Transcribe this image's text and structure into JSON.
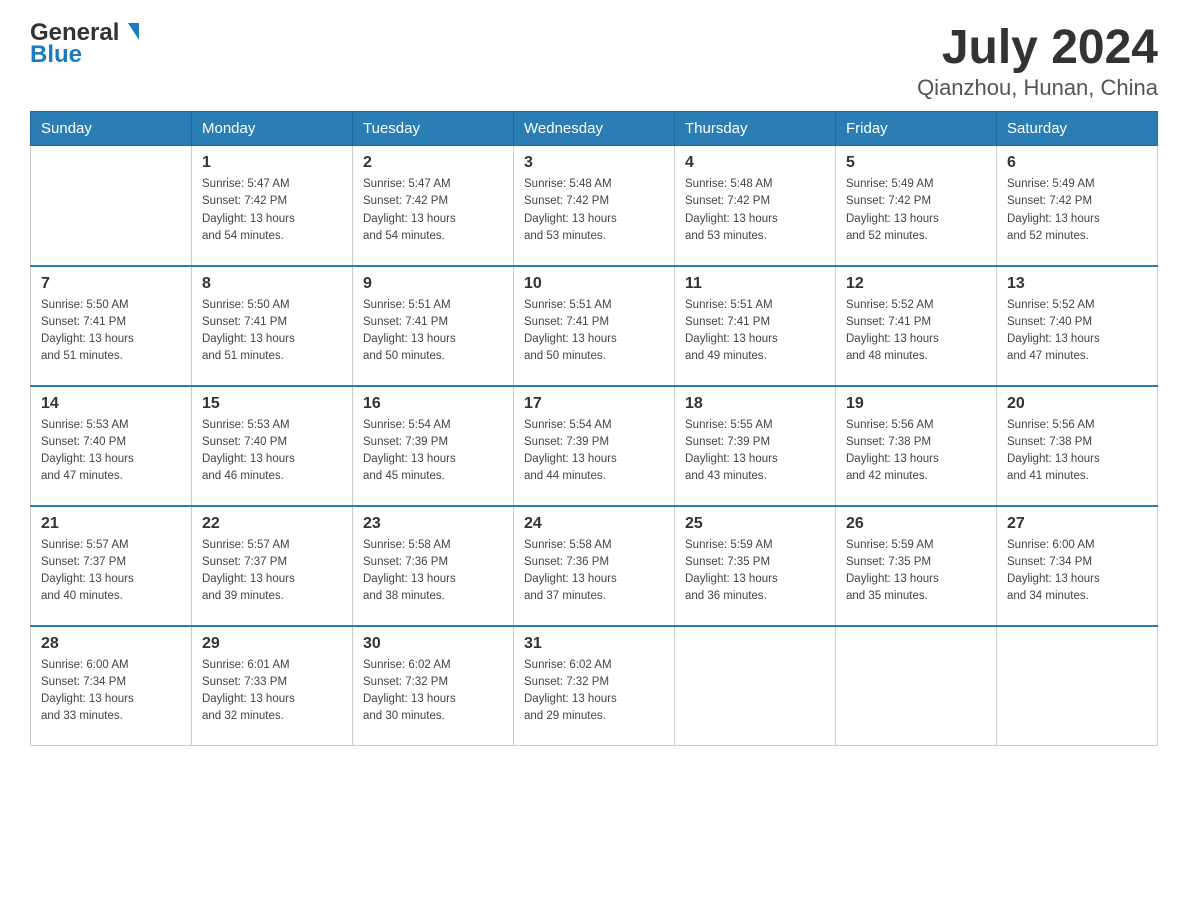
{
  "header": {
    "logo_text_general": "General",
    "logo_text_blue": "Blue",
    "title": "July 2024",
    "subtitle": "Qianzhou, Hunan, China"
  },
  "days_of_week": [
    "Sunday",
    "Monday",
    "Tuesday",
    "Wednesday",
    "Thursday",
    "Friday",
    "Saturday"
  ],
  "weeks": [
    [
      null,
      {
        "day": "1",
        "sunrise": "5:47 AM",
        "sunset": "7:42 PM",
        "daylight_hours": "13",
        "daylight_minutes": "54"
      },
      {
        "day": "2",
        "sunrise": "5:47 AM",
        "sunset": "7:42 PM",
        "daylight_hours": "13",
        "daylight_minutes": "54"
      },
      {
        "day": "3",
        "sunrise": "5:48 AM",
        "sunset": "7:42 PM",
        "daylight_hours": "13",
        "daylight_minutes": "53"
      },
      {
        "day": "4",
        "sunrise": "5:48 AM",
        "sunset": "7:42 PM",
        "daylight_hours": "13",
        "daylight_minutes": "53"
      },
      {
        "day": "5",
        "sunrise": "5:49 AM",
        "sunset": "7:42 PM",
        "daylight_hours": "13",
        "daylight_minutes": "52"
      },
      {
        "day": "6",
        "sunrise": "5:49 AM",
        "sunset": "7:42 PM",
        "daylight_hours": "13",
        "daylight_minutes": "52"
      }
    ],
    [
      {
        "day": "7",
        "sunrise": "5:50 AM",
        "sunset": "7:41 PM",
        "daylight_hours": "13",
        "daylight_minutes": "51"
      },
      {
        "day": "8",
        "sunrise": "5:50 AM",
        "sunset": "7:41 PM",
        "daylight_hours": "13",
        "daylight_minutes": "51"
      },
      {
        "day": "9",
        "sunrise": "5:51 AM",
        "sunset": "7:41 PM",
        "daylight_hours": "13",
        "daylight_minutes": "50"
      },
      {
        "day": "10",
        "sunrise": "5:51 AM",
        "sunset": "7:41 PM",
        "daylight_hours": "13",
        "daylight_minutes": "50"
      },
      {
        "day": "11",
        "sunrise": "5:51 AM",
        "sunset": "7:41 PM",
        "daylight_hours": "13",
        "daylight_minutes": "49"
      },
      {
        "day": "12",
        "sunrise": "5:52 AM",
        "sunset": "7:41 PM",
        "daylight_hours": "13",
        "daylight_minutes": "48"
      },
      {
        "day": "13",
        "sunrise": "5:52 AM",
        "sunset": "7:40 PM",
        "daylight_hours": "13",
        "daylight_minutes": "47"
      }
    ],
    [
      {
        "day": "14",
        "sunrise": "5:53 AM",
        "sunset": "7:40 PM",
        "daylight_hours": "13",
        "daylight_minutes": "47"
      },
      {
        "day": "15",
        "sunrise": "5:53 AM",
        "sunset": "7:40 PM",
        "daylight_hours": "13",
        "daylight_minutes": "46"
      },
      {
        "day": "16",
        "sunrise": "5:54 AM",
        "sunset": "7:39 PM",
        "daylight_hours": "13",
        "daylight_minutes": "45"
      },
      {
        "day": "17",
        "sunrise": "5:54 AM",
        "sunset": "7:39 PM",
        "daylight_hours": "13",
        "daylight_minutes": "44"
      },
      {
        "day": "18",
        "sunrise": "5:55 AM",
        "sunset": "7:39 PM",
        "daylight_hours": "13",
        "daylight_minutes": "43"
      },
      {
        "day": "19",
        "sunrise": "5:56 AM",
        "sunset": "7:38 PM",
        "daylight_hours": "13",
        "daylight_minutes": "42"
      },
      {
        "day": "20",
        "sunrise": "5:56 AM",
        "sunset": "7:38 PM",
        "daylight_hours": "13",
        "daylight_minutes": "41"
      }
    ],
    [
      {
        "day": "21",
        "sunrise": "5:57 AM",
        "sunset": "7:37 PM",
        "daylight_hours": "13",
        "daylight_minutes": "40"
      },
      {
        "day": "22",
        "sunrise": "5:57 AM",
        "sunset": "7:37 PM",
        "daylight_hours": "13",
        "daylight_minutes": "39"
      },
      {
        "day": "23",
        "sunrise": "5:58 AM",
        "sunset": "7:36 PM",
        "daylight_hours": "13",
        "daylight_minutes": "38"
      },
      {
        "day": "24",
        "sunrise": "5:58 AM",
        "sunset": "7:36 PM",
        "daylight_hours": "13",
        "daylight_minutes": "37"
      },
      {
        "day": "25",
        "sunrise": "5:59 AM",
        "sunset": "7:35 PM",
        "daylight_hours": "13",
        "daylight_minutes": "36"
      },
      {
        "day": "26",
        "sunrise": "5:59 AM",
        "sunset": "7:35 PM",
        "daylight_hours": "13",
        "daylight_minutes": "35"
      },
      {
        "day": "27",
        "sunrise": "6:00 AM",
        "sunset": "7:34 PM",
        "daylight_hours": "13",
        "daylight_minutes": "34"
      }
    ],
    [
      {
        "day": "28",
        "sunrise": "6:00 AM",
        "sunset": "7:34 PM",
        "daylight_hours": "13",
        "daylight_minutes": "33"
      },
      {
        "day": "29",
        "sunrise": "6:01 AM",
        "sunset": "7:33 PM",
        "daylight_hours": "13",
        "daylight_minutes": "32"
      },
      {
        "day": "30",
        "sunrise": "6:02 AM",
        "sunset": "7:32 PM",
        "daylight_hours": "13",
        "daylight_minutes": "30"
      },
      {
        "day": "31",
        "sunrise": "6:02 AM",
        "sunset": "7:32 PM",
        "daylight_hours": "13",
        "daylight_minutes": "29"
      },
      null,
      null,
      null
    ]
  ]
}
